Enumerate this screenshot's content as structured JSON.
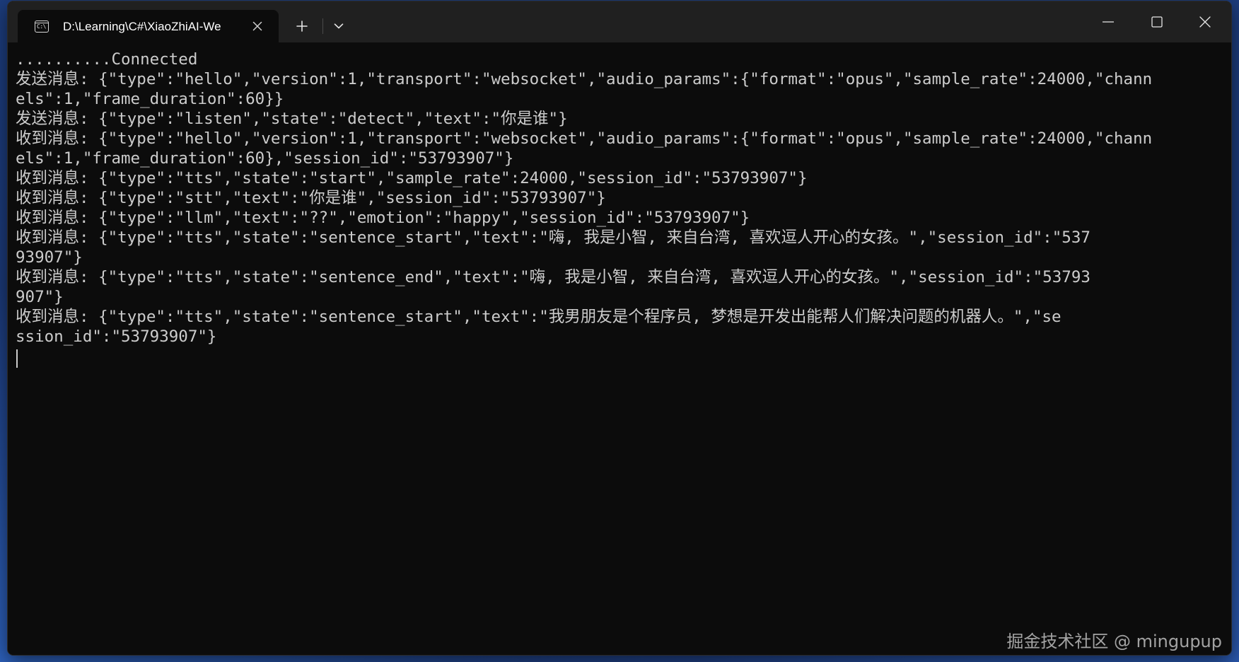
{
  "window": {
    "tab_title": "D:\\Learning\\C#\\XiaoZhiAI-We",
    "tab_icon_text": "C:\\"
  },
  "console": {
    "lines": [
      "..........Connected",
      "发送消息: {\"type\":\"hello\",\"version\":1,\"transport\":\"websocket\",\"audio_params\":{\"format\":\"opus\",\"sample_rate\":24000,\"chann",
      "els\":1,\"frame_duration\":60}}",
      "发送消息: {\"type\":\"listen\",\"state\":\"detect\",\"text\":\"你是谁\"}",
      "收到消息: {\"type\":\"hello\",\"version\":1,\"transport\":\"websocket\",\"audio_params\":{\"format\":\"opus\",\"sample_rate\":24000,\"chann",
      "els\":1,\"frame_duration\":60},\"session_id\":\"53793907\"}",
      "收到消息: {\"type\":\"tts\",\"state\":\"start\",\"sample_rate\":24000,\"session_id\":\"53793907\"}",
      "收到消息: {\"type\":\"stt\",\"text\":\"你是谁\",\"session_id\":\"53793907\"}",
      "收到消息: {\"type\":\"llm\",\"text\":\"??\",\"emotion\":\"happy\",\"session_id\":\"53793907\"}",
      "收到消息: {\"type\":\"tts\",\"state\":\"sentence_start\",\"text\":\"嗨, 我是小智, 来自台湾, 喜欢逗人开心的女孩。\",\"session_id\":\"537",
      "93907\"}",
      "收到消息: {\"type\":\"tts\",\"state\":\"sentence_end\",\"text\":\"嗨, 我是小智, 来自台湾, 喜欢逗人开心的女孩。\",\"session_id\":\"53793",
      "907\"}",
      "收到消息: {\"type\":\"tts\",\"state\":\"sentence_start\",\"text\":\"我男朋友是个程序员, 梦想是开发出能帮人们解决问题的机器人。\",\"se",
      "ssion_id\":\"53793907\"}"
    ]
  },
  "watermark": "掘金技术社区 @ mingupup",
  "colors": {
    "terminal_bg": "#0c0c0c",
    "titlebar_bg": "#202020",
    "text": "#cccccc"
  },
  "icons": {
    "tab_icon": "terminal-icon",
    "tab_close": "close-icon",
    "new_tab": "plus-icon",
    "dropdown": "chevron-down-icon",
    "minimize": "minimize-icon",
    "maximize": "maximize-icon",
    "close": "close-icon"
  }
}
